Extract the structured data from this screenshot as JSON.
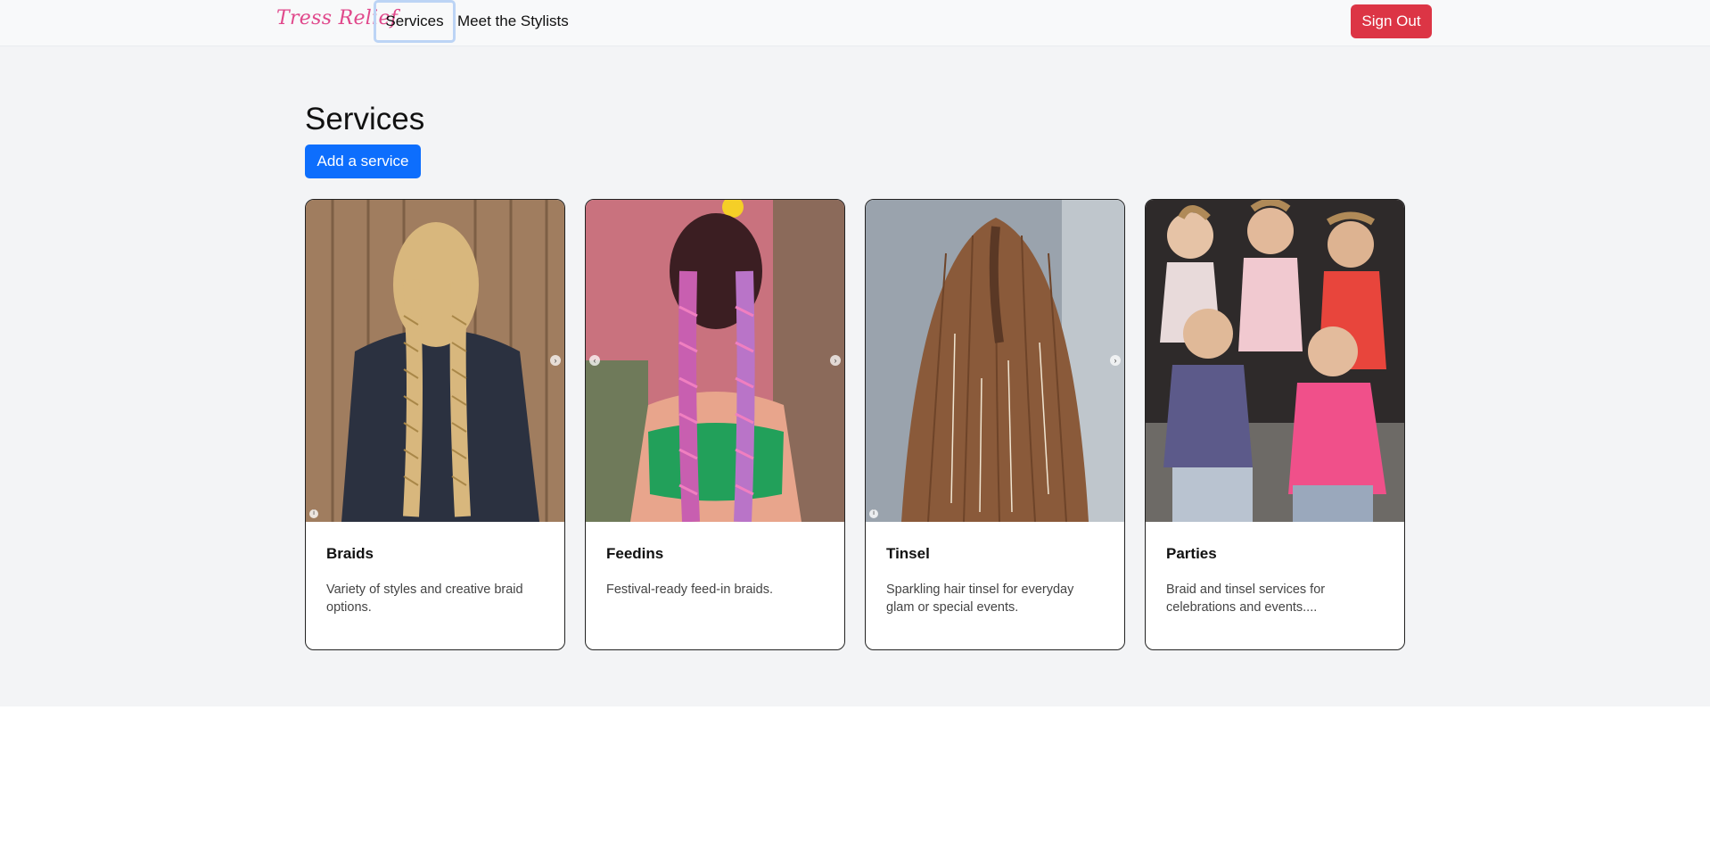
{
  "navbar": {
    "brand": "Tress Relief",
    "links": [
      {
        "label": "Services",
        "active": true
      },
      {
        "label": "Meet the Stylists",
        "active": false
      }
    ],
    "signout_label": "Sign Out"
  },
  "main": {
    "title": "Services",
    "add_label": "Add a service",
    "cards": [
      {
        "title": "Braids",
        "description": "Variety of styles and creative braid options.",
        "image": "two blonde dutch braids on dark shirt"
      },
      {
        "title": "Feedins",
        "description": "Festival-ready feed-in braids.",
        "image": "pink and purple feed-in braids, green top"
      },
      {
        "title": "Tinsel",
        "description": "Sparkling hair tinsel for everyday glam or special events.",
        "image": "long brown hair with tinsel strands"
      },
      {
        "title": "Parties",
        "description": "Braid and tinsel services for celebrations and events....",
        "image": "group of girls with braids sitting on steps"
      }
    ]
  },
  "colors": {
    "brand": "#e0488b",
    "primary": "#0d6efd",
    "danger": "#dc3545",
    "page_bg": "#f3f4f6"
  }
}
